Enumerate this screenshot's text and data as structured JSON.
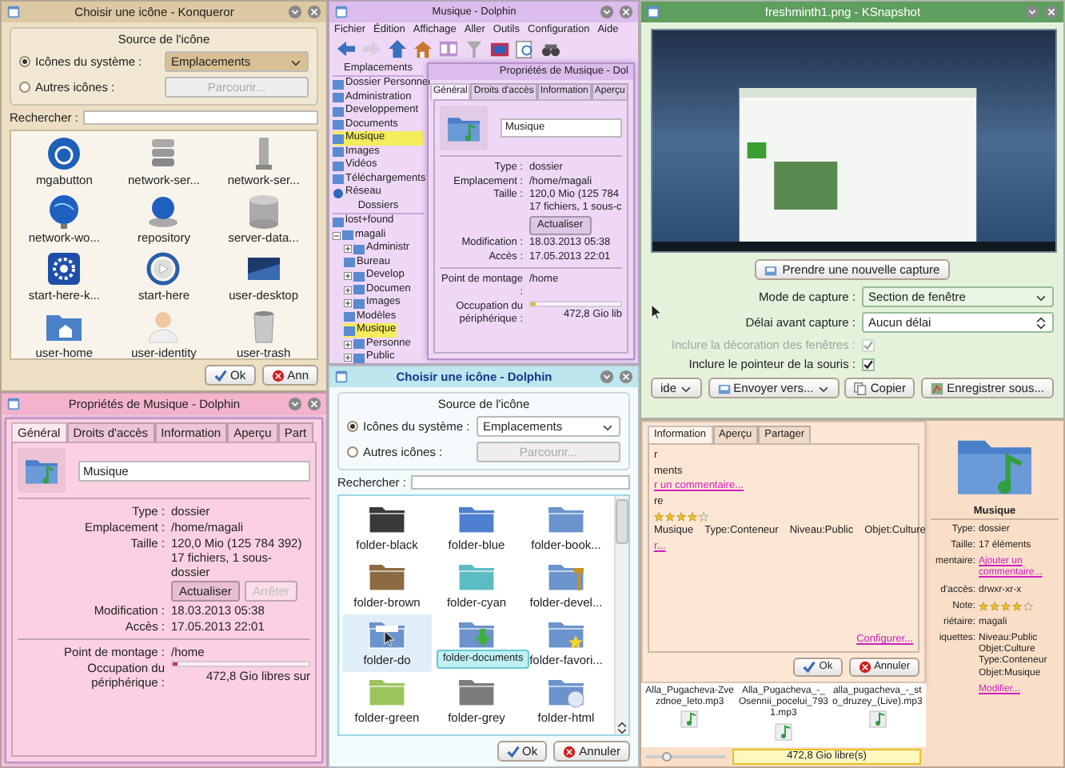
{
  "windows": [
    {
      "kind": "icon_chooser",
      "title": "Choisir une icône - Konqueror",
      "group_title": "Source de l'icône",
      "sources": [
        {
          "label": "Icônes du système :",
          "selected": true
        },
        {
          "label": "Autres icônes :",
          "selected": false
        }
      ],
      "dropdown": "Emplacements",
      "browse": {
        "label": "Parcourir...",
        "disabled": true
      },
      "search_label": "Rechercher :",
      "icons": [
        {
          "label": "mgabutton",
          "kind": "badge",
          "selected": false
        },
        {
          "label": "network-ser...",
          "kind": "server",
          "selected": false
        },
        {
          "label": "network-ser...",
          "kind": "tower",
          "selected": false
        },
        {
          "label": "network-wo...",
          "kind": "globe",
          "selected": false
        },
        {
          "label": "repository",
          "kind": "globe-base",
          "selected": false
        },
        {
          "label": "server-data...",
          "kind": "database",
          "selected": false
        },
        {
          "label": "start-here-k...",
          "kind": "gear",
          "selected": false
        },
        {
          "label": "start-here",
          "kind": "play",
          "selected": false
        },
        {
          "label": "user-desktop",
          "kind": "desktop",
          "selected": false
        },
        {
          "label": "user-home",
          "kind": "home",
          "selected": false
        },
        {
          "label": "user-identity",
          "kind": "person",
          "selected": false
        },
        {
          "label": "user-trash",
          "kind": "trash",
          "selected": false
        }
      ],
      "buttons": [
        {
          "label": "Ok",
          "kind": "ok"
        },
        {
          "label": "Ann",
          "kind": "cancel"
        }
      ]
    },
    {
      "kind": "file_manager",
      "title": "Musique - Dolphin",
      "menu": [
        "Fichier",
        "Édition",
        "Affichage",
        "Aller",
        "Outils",
        "Configuration",
        "Aide"
      ],
      "toolbar": [
        {
          "kind": "back",
          "disabled": false
        },
        {
          "kind": "forward",
          "disabled": true
        },
        {
          "kind": "up",
          "disabled": false
        },
        {
          "kind": "home",
          "disabled": false
        },
        {
          "kind": "split",
          "disabled": false
        },
        {
          "kind": "filter",
          "disabled": false
        },
        {
          "kind": "preview",
          "disabled": false
        },
        {
          "kind": "zoom",
          "disabled": false
        },
        {
          "kind": "find",
          "disabled": false
        }
      ],
      "places_title": "Emplacements",
      "places": [
        {
          "label": "Dossier Personnel",
          "kind": "folder",
          "selected": false
        },
        {
          "label": "Administration",
          "kind": "folder",
          "selected": false
        },
        {
          "label": "Developpement",
          "kind": "folder",
          "selected": false
        },
        {
          "label": "Documents",
          "kind": "folder",
          "selected": false
        },
        {
          "label": "Musique",
          "kind": "folder",
          "selected": true
        },
        {
          "label": "Images",
          "kind": "folder",
          "selected": false
        },
        {
          "label": "Vidéos",
          "kind": "folder",
          "selected": false
        },
        {
          "label": "Téléchargements",
          "kind": "folder",
          "selected": false
        },
        {
          "label": "Réseau",
          "kind": "network",
          "selected": false
        }
      ],
      "folders_title": "Dossiers",
      "tree": [
        {
          "label": "lost+found",
          "selected": false
        },
        {
          "label": "magali",
          "selected": false,
          "expanded": true,
          "children": [
            {
              "label": "Administr",
              "selected": false,
              "expanded": false
            },
            {
              "label": "Bureau",
              "selected": false
            },
            {
              "label": "Develop",
              "selected": false,
              "expanded": false
            },
            {
              "label": "Documen",
              "selected": false,
              "expanded": false
            },
            {
              "label": "Images",
              "selected": false,
              "expanded": false
            },
            {
              "label": "Modèles",
              "selected": false
            },
            {
              "label": "Musique",
              "selected": true
            },
            {
              "label": "Personne",
              "selected": false,
              "expanded": false
            },
            {
              "label": "Public",
              "selected": false,
              "expanded": false
            }
          ]
        }
      ],
      "dialog": {
        "title": "Propriétés de Musique - Dol",
        "tabs": [
          {
            "label": "Général",
            "selected": true
          },
          {
            "label": "Droits d'accès",
            "selected": false
          },
          {
            "label": "Information",
            "selected": false
          },
          {
            "label": "Aperçu",
            "selected": false
          }
        ],
        "name": "Musique",
        "info": [
          {
            "label": "Type :",
            "lines": [
              "dossier"
            ]
          },
          {
            "label": "Emplacement :",
            "lines": [
              "/home/magali"
            ]
          },
          {
            "label": "Taille :",
            "lines": [
              "120,0 Mio (125 784",
              "17 fichiers, 1 sous-c"
            ]
          }
        ],
        "actions": [
          {
            "label": "Actualiser",
            "disabled": false
          }
        ],
        "dates": [
          {
            "label": "Modification :",
            "lines": [
              "18.03.2013 05:38"
            ]
          },
          {
            "label": "Accès :",
            "lines": [
              "17.05.2013 22:01"
            ]
          }
        ],
        "mount": {
          "label": "Point de montage :",
          "value": "/home"
        },
        "usage": {
          "label": "Occupation du périphérique :",
          "level": 0.05,
          "reading": "472,8 Gio lib"
        }
      }
    },
    {
      "kind": "snapshot",
      "title": "freshminth1.png - KSnapshot",
      "capture_button": "Prendre une nouvelle capture",
      "options": [
        {
          "kind": "select",
          "label": "Mode de capture :",
          "value": "Section de fenêtre"
        },
        {
          "kind": "spin",
          "label": "Délai avant capture :",
          "value": "Aucun délai"
        },
        {
          "kind": "check",
          "label": "Inclure la décoration des fenêtres :",
          "checked": true,
          "disabled": true
        },
        {
          "kind": "check",
          "label": "Inclure le pointeur de la souris :",
          "checked": true,
          "disabled": false
        }
      ],
      "buttons": [
        {
          "label": "ide",
          "kind": "help",
          "menu": true
        },
        {
          "label": "Envoyer vers...",
          "kind": "send",
          "menu": true
        },
        {
          "label": "Copier",
          "kind": "copy",
          "menu": false
        },
        {
          "label": "Enregistrer sous...",
          "kind": "save",
          "menu": false
        }
      ]
    },
    {
      "kind": "properties",
      "title": "Propriétés de Musique - Dolphin",
      "tabs": [
        {
          "label": "Général",
          "selected": true
        },
        {
          "label": "Droits d'accès",
          "selected": false
        },
        {
          "label": "Information",
          "selected": false
        },
        {
          "label": "Aperçu",
          "selected": false
        },
        {
          "label": "Part",
          "selected": false
        }
      ],
      "name": "Musique",
      "info": [
        {
          "label": "Type :",
          "lines": [
            "dossier"
          ]
        },
        {
          "label": "Emplacement :",
          "lines": [
            "/home/magali"
          ]
        },
        {
          "label": "Taille :",
          "lines": [
            "120,0 Mio (125 784 392)",
            "17 fichiers, 1 sous-dossier"
          ]
        }
      ],
      "actions": [
        {
          "label": "Actualiser",
          "disabled": false
        },
        {
          "label": "Arrêter",
          "disabled": true
        }
      ],
      "dates": [
        {
          "label": "Modification :",
          "lines": [
            "18.03.2013 05:38"
          ]
        },
        {
          "label": "Accès :",
          "lines": [
            "17.05.2013 22:01"
          ]
        }
      ],
      "mount": {
        "label": "Point de montage :",
        "value": "/home"
      },
      "usage": {
        "label": "Occupation du périphérique :",
        "level": 0.04,
        "reading": "472,8 Gio libres sur"
      }
    },
    {
      "kind": "icon_chooser",
      "title": "Choisir une icône - Dolphin",
      "group_title": "Source de l'icône",
      "sources": [
        {
          "label": "Icônes du système :",
          "selected": true
        },
        {
          "label": "Autres icônes :",
          "selected": false
        }
      ],
      "dropdown": "Emplacements",
      "browse": {
        "label": "Parcourir...",
        "disabled": true
      },
      "search_label": "Rechercher :",
      "scrollbar": true,
      "icons": [
        {
          "label": "folder-black",
          "kind": "folder",
          "color": "#3a3a3a",
          "selected": false
        },
        {
          "label": "folder-blue",
          "kind": "folder",
          "color": "#4f7fd0",
          "selected": false
        },
        {
          "label": "folder-book...",
          "kind": "folder",
          "color": "#6b93cc",
          "selected": false
        },
        {
          "label": "folder-brown",
          "kind": "folder",
          "color": "#8c6a42",
          "selected": false
        },
        {
          "label": "folder-cyan",
          "kind": "folder",
          "color": "#5cbcc4",
          "selected": false
        },
        {
          "label": "folder-devel...",
          "kind": "toolfolder",
          "color": "#6b93cc",
          "selected": false
        },
        {
          "label": "folder-do",
          "kind": "paperfolder",
          "color": "#6b93cc",
          "selected": true
        },
        {
          "kind": "downloadfolder",
          "color": "#6b93cc",
          "selected": false
        },
        {
          "label": "folder-favori...",
          "kind": "starfolder",
          "color": "#6b93cc",
          "selected": false
        },
        {
          "label": "folder-green",
          "kind": "folder",
          "color": "#9cc45c",
          "selected": false
        },
        {
          "label": "folder-grey",
          "kind": "folder",
          "color": "#7c7c7c",
          "selected": false
        },
        {
          "label": "folder-html",
          "kind": "webfolder",
          "color": "#6b93cc",
          "selected": false
        }
      ],
      "tooltip": "folder-documents",
      "buttons": [
        {
          "label": "Ok",
          "kind": "ok"
        },
        {
          "label": "Annuler",
          "kind": "cancel"
        }
      ]
    },
    {
      "kind": "details",
      "tabs": [
        {
          "label": "Information",
          "selected": true
        },
        {
          "label": "Aperçu",
          "selected": false
        },
        {
          "label": "Partager",
          "selected": false
        }
      ],
      "lines": [
        {
          "kind": "text",
          "text": "r"
        },
        {
          "kind": "text",
          "text": "ments"
        },
        {
          "kind": "link",
          "text": "r un commentaire..."
        },
        {
          "kind": "text",
          "text": "re"
        },
        {
          "kind": "stars",
          "stars": 4
        },
        {
          "kind": "tags",
          "items": [
            "Musique",
            "Type:Conteneur",
            "Niveau:Public",
            "Objet:Culture"
          ]
        },
        {
          "kind": "link",
          "text": "r..."
        }
      ],
      "configure": "Configurer...",
      "buttons": [
        {
          "label": "Ok",
          "kind": "ok"
        },
        {
          "label": "Annuler",
          "kind": "cancel"
        }
      ],
      "files": [
        "Alla_Pugacheva-Zvezdnoe_leto.mp3",
        "Alla_Pugacheva_-_Osennii_pocelui_7931.mp3",
        "alla_pugacheva_-_sto_druzey_(Live).mp3"
      ],
      "zoom": {
        "level": 0.25
      },
      "free_space": "472,8 Gio libre(s)",
      "panel": {
        "name": "Musique",
        "rows": [
          {
            "kind": "text",
            "label": "Type:",
            "value": "dossier"
          },
          {
            "kind": "text",
            "label": "Taille:",
            "value": "17 éléments"
          },
          {
            "kind": "link",
            "label": "mentaire:",
            "value": "Ajouter un commentaire..."
          },
          {
            "kind": "text",
            "label": "d'accès:",
            "value": "drwxr-xr-x"
          },
          {
            "kind": "stars",
            "label": "Note:",
            "stars": 4
          },
          {
            "kind": "text",
            "label": "riétaire:",
            "value": "magali"
          },
          {
            "kind": "text",
            "label": "iquettes:",
            "value": "Niveau:Public Objet:Culture Type:Conteneur Objet:Musique"
          },
          {
            "kind": "link",
            "value": "Modifier..."
          }
        ]
      }
    }
  ]
}
